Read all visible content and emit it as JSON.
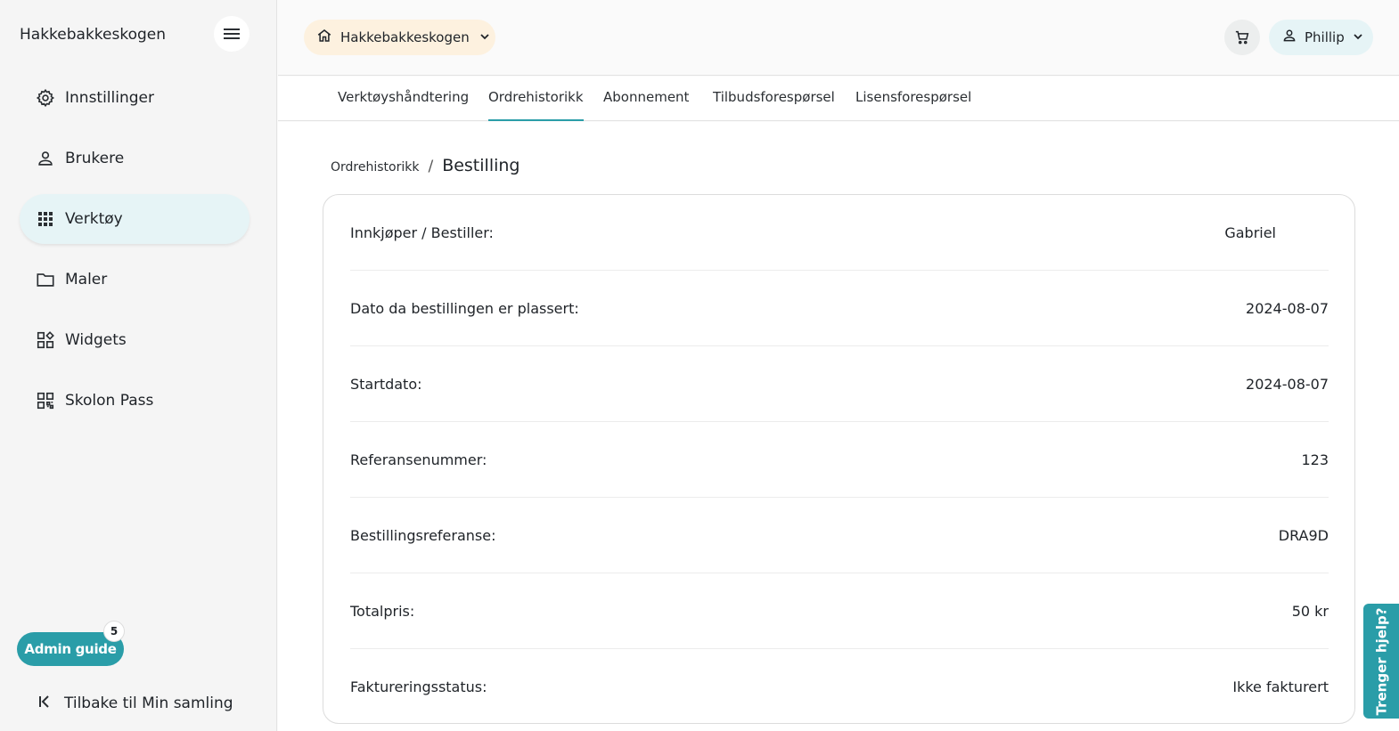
{
  "sidebar": {
    "org_name": "Hakkebakkeskogen",
    "items": [
      {
        "label": "Innstillinger",
        "icon": "gear-icon"
      },
      {
        "label": "Brukere",
        "icon": "user-icon"
      },
      {
        "label": "Verktøy",
        "icon": "grid-icon",
        "active": true
      },
      {
        "label": "Maler",
        "icon": "folder-icon"
      },
      {
        "label": "Widgets",
        "icon": "widgets-icon"
      },
      {
        "label": "Skolon Pass",
        "icon": "qr-icon"
      }
    ],
    "admin_guide": {
      "label": "Admin guide",
      "badge": "5"
    },
    "back_label": "Tilbake til Min samling"
  },
  "header": {
    "org_selector": "Hakkebakkeskogen",
    "user_name": "Phillip"
  },
  "tabs": [
    {
      "label": "Verktøyshåndtering"
    },
    {
      "label": "Ordrehistorikk",
      "active": true
    },
    {
      "label": "Abonnement"
    },
    {
      "label": "Tilbudsforespørsel"
    },
    {
      "label": "Lisensforespørsel"
    }
  ],
  "breadcrumb": {
    "parent": "Ordrehistorikk",
    "separator": "/",
    "current": "Bestilling"
  },
  "order": {
    "rows": [
      {
        "label": "Innkjøper / Bestiller:",
        "value": "Gabriel"
      },
      {
        "label": "Dato da bestillingen er plassert:",
        "value": "2024-08-07"
      },
      {
        "label": "Startdato:",
        "value": "2024-08-07"
      },
      {
        "label": "Referansenummer:",
        "value": "123"
      },
      {
        "label": "Bestillingsreferanse:",
        "value": "DRA9D"
      },
      {
        "label": "Totalpris:",
        "value": "50 kr"
      },
      {
        "label": "Faktureringsstatus:",
        "value": "Ikke fakturert"
      }
    ]
  },
  "help_tab": "Trenger hjelp?",
  "colors": {
    "accent": "#2a9da8",
    "active_bg": "#e6f4f6",
    "org_chip_bg": "#fdf1df"
  }
}
